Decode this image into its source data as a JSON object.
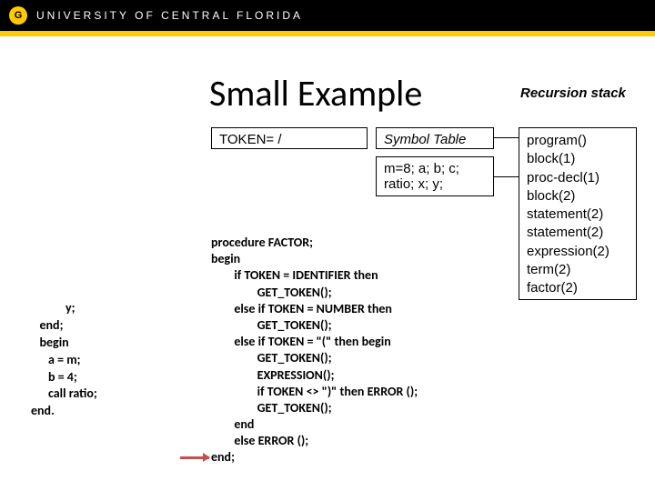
{
  "banner": {
    "logo_letter": "G",
    "text": "UNIVERSITY OF CENTRAL FLORIDA"
  },
  "title": "Small Example",
  "recursion_title": "Recursion stack",
  "token_box": "TOKEN= /",
  "symbol_title": "Symbol Table",
  "symbol_content": "m=8; a; b; c; ratio; x; y;",
  "stack": "program()\nblock(1)\nproc-decl(1)\nblock(2)\nstatement(2)\nstatement(2)\nexpression(2)\nterm(2)\nfactor(2)",
  "code_left": "            y;\n   end;\n   begin\n      a = m;\n      b = 4;\n      call ratio;\nend.",
  "code_right": "procedure FACTOR;\nbegin\n        if TOKEN = IDENTIFIER then\n                GET_TOKEN();\n        else if TOKEN = NUMBER then\n                GET_TOKEN();\n        else if TOKEN = \"(\" then begin\n                GET_TOKEN();\n                EXPRESSION();\n                if TOKEN <> \")\" then ERROR ();\n                GET_TOKEN();\n        end\n        else ERROR ();\nend;"
}
